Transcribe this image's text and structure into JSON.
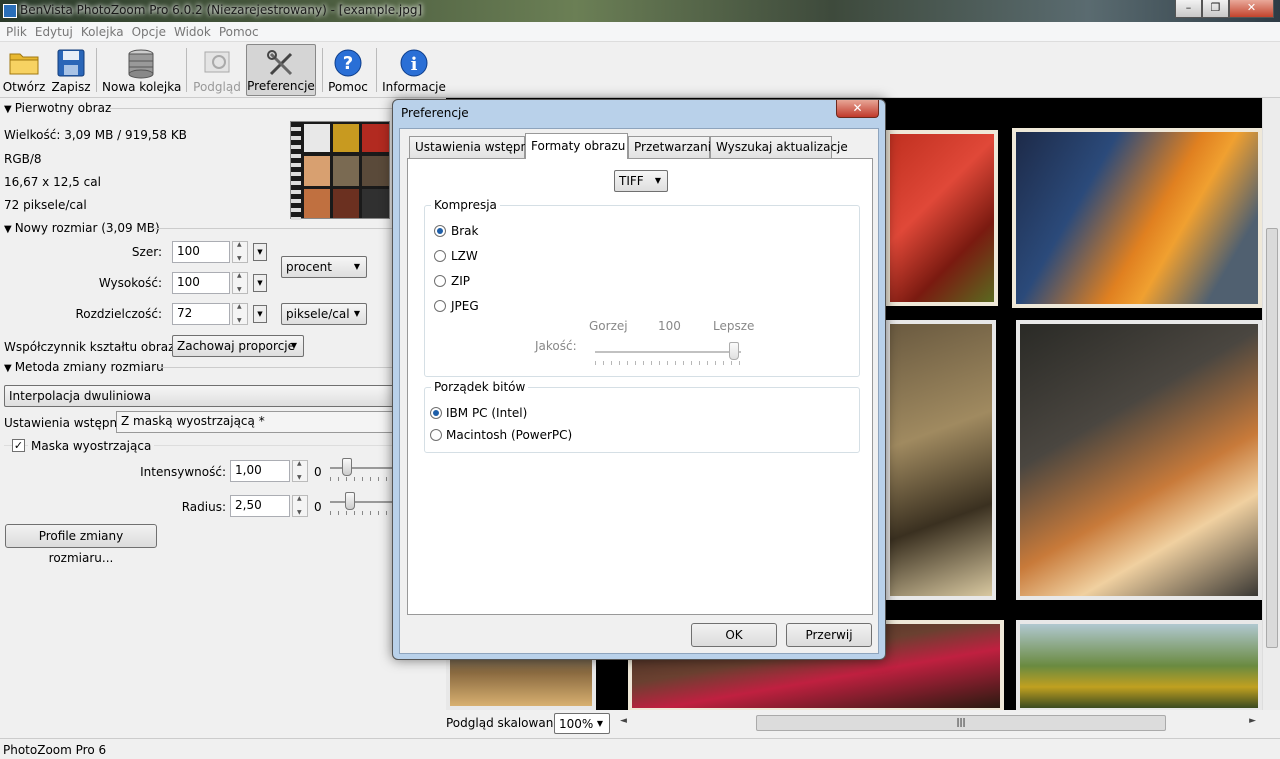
{
  "window": {
    "title": "BenVista PhotoZoom Pro 6.0.2 (Niezarejestrowany) - [example.jpg]"
  },
  "menu": [
    "Plik",
    "Edytuj",
    "Kolejka",
    "Opcje",
    "Widok",
    "Pomoc"
  ],
  "toolbar": {
    "open": "Otwórz",
    "save": "Zapisz",
    "new_queue": "Nowa kolejka",
    "preview": "Podgląd",
    "preferences": "Preferencje",
    "help": "Pomoc",
    "info": "Informacje"
  },
  "original": {
    "header": "Pierwotny obraz",
    "size": "Wielkość: 3,09 MB / 919,58 KB",
    "mode": "RGB/8",
    "dims": "16,67 x 12,5 cal",
    "dpi": "72 piksele/cal"
  },
  "newsize": {
    "header": "Nowy rozmiar (3,09 MB)",
    "width_label": "Szer:",
    "width_value": "100",
    "height_label": "Wysokość:",
    "height_value": "100",
    "res_label": "Rozdzielczość:",
    "res_value": "72",
    "unit": "procent",
    "res_unit": "piksele/cal",
    "aspect_label": "Współczynnik kształtu obrazu:",
    "aspect_value": "Zachowaj proporcje"
  },
  "method": {
    "header": "Metoda zmiany rozmiaru",
    "interp": "Interpolacja dwuliniowa",
    "preset_label": "Ustawienia wstępne:",
    "preset_value": "Z maską wyostrzającą *",
    "mask_label": "Maska wyostrzająca",
    "intensity_label": "Intensywność:",
    "intensity_value": "1,00",
    "intensity_min": "0",
    "radius_label": "Radius:",
    "radius_value": "2,50",
    "radius_min": "0",
    "profiles_button": "Profile zmiany rozmiaru..."
  },
  "bottom": {
    "scale_label": "Podgląd skalowania",
    "scale_value": "100%"
  },
  "status": "PhotoZoom Pro 6",
  "dialog": {
    "title": "Preferencje",
    "tabs": [
      "Ustawienia wstępne",
      "Formaty obrazu",
      "Przetwarzanie",
      "Wyszukaj aktualizacje"
    ],
    "format": "TIFF",
    "compression": {
      "title": "Kompresja",
      "options": [
        "Brak",
        "LZW",
        "ZIP",
        "JPEG"
      ],
      "selected": "Brak",
      "quality_label": "Jakość:",
      "worse": "Gorzej",
      "quality_value": "100",
      "better": "Lepsze"
    },
    "byteorder": {
      "title": "Porządek bitów",
      "options": [
        "IBM PC (Intel)",
        "Macintosh (PowerPC)"
      ],
      "selected": "IBM PC (Intel)"
    },
    "ok": "OK",
    "cancel": "Przerwij"
  }
}
